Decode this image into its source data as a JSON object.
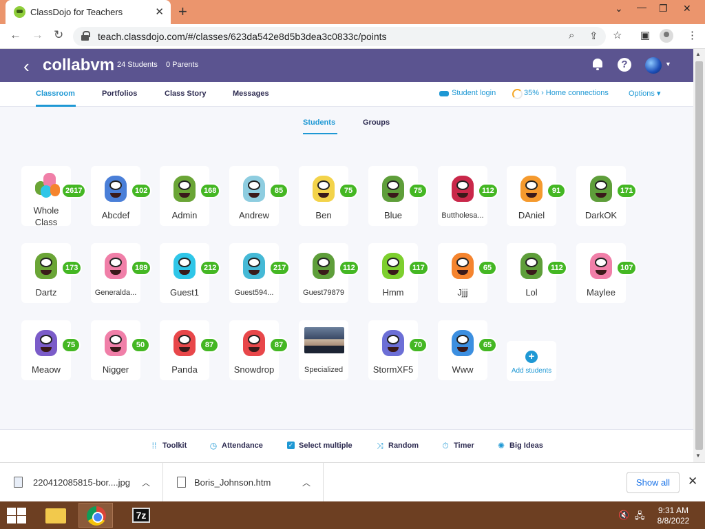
{
  "browser": {
    "tab_title": "ClassDojo for Teachers",
    "url": "teach.classdojo.com/#/classes/623da542e8d5b3dea3c0833c/points"
  },
  "header": {
    "class_name": "collabvm",
    "students_count": "24 Students",
    "parents_count": "0 Parents"
  },
  "nav": {
    "tabs": [
      "Classroom",
      "Portfolios",
      "Class Story",
      "Messages"
    ],
    "student_login": "Student login",
    "home_connections": "35% › Home connections",
    "options": "Options"
  },
  "subtabs": [
    "Students",
    "Groups"
  ],
  "whole_class": {
    "name": "Whole Class",
    "points": "2617"
  },
  "students": [
    {
      "name": "Abcdef",
      "points": "102",
      "color": "#4a7fd8"
    },
    {
      "name": "Admin",
      "points": "168",
      "color": "#6aa536"
    },
    {
      "name": "Andrew",
      "points": "85",
      "color": "#8ecde0"
    },
    {
      "name": "Ben",
      "points": "75",
      "color": "#f3d34a"
    },
    {
      "name": "Blue",
      "points": "75",
      "color": "#5e9e3a"
    },
    {
      "name": "Buttholesa...",
      "points": "112",
      "color": "#c9284a"
    },
    {
      "name": "DAniel",
      "points": "91",
      "color": "#f59a2e"
    },
    {
      "name": "DarkOK",
      "points": "171",
      "color": "#5e9e3a"
    },
    {
      "name": "Dartz",
      "points": "173",
      "color": "#6aa536"
    },
    {
      "name": "Generalda...",
      "points": "189",
      "color": "#f07fa8"
    },
    {
      "name": "Guest1",
      "points": "212",
      "color": "#2fc6e8"
    },
    {
      "name": "Guest594...",
      "points": "217",
      "color": "#45b9d6"
    },
    {
      "name": "Guest79879",
      "points": "112",
      "color": "#5e9e3a"
    },
    {
      "name": "Hmm",
      "points": "117",
      "color": "#7dcf2e"
    },
    {
      "name": "Jjjj",
      "points": "65",
      "color": "#f5842e"
    },
    {
      "name": "Lol",
      "points": "112",
      "color": "#5e9e3a"
    },
    {
      "name": "Maylee",
      "points": "107",
      "color": "#f07fa8"
    },
    {
      "name": "Meaow",
      "points": "75",
      "color": "#7b5cc9"
    },
    {
      "name": "Nigger",
      "points": "50",
      "color": "#f07fa8"
    },
    {
      "name": "Panda",
      "points": "87",
      "color": "#e8474a"
    },
    {
      "name": "Snowdrop",
      "points": "87",
      "color": "#e8474a"
    },
    {
      "name": "Specialized",
      "points": "",
      "color": ""
    },
    {
      "name": "StormXF5",
      "points": "70",
      "color": "#6c6fd6"
    },
    {
      "name": "Www",
      "points": "65",
      "color": "#3c8fe0"
    }
  ],
  "add_students": "Add students",
  "bottom_toolbar": [
    "Toolkit",
    "Attendance",
    "Select multiple",
    "Random",
    "Timer",
    "Big Ideas"
  ],
  "downloads": {
    "files": [
      "220412085815-bor....jpg",
      "Boris_Johnson.htm"
    ],
    "show_all": "Show all"
  },
  "taskbar": {
    "time": "9:31 AM",
    "date": "8/8/2022"
  }
}
